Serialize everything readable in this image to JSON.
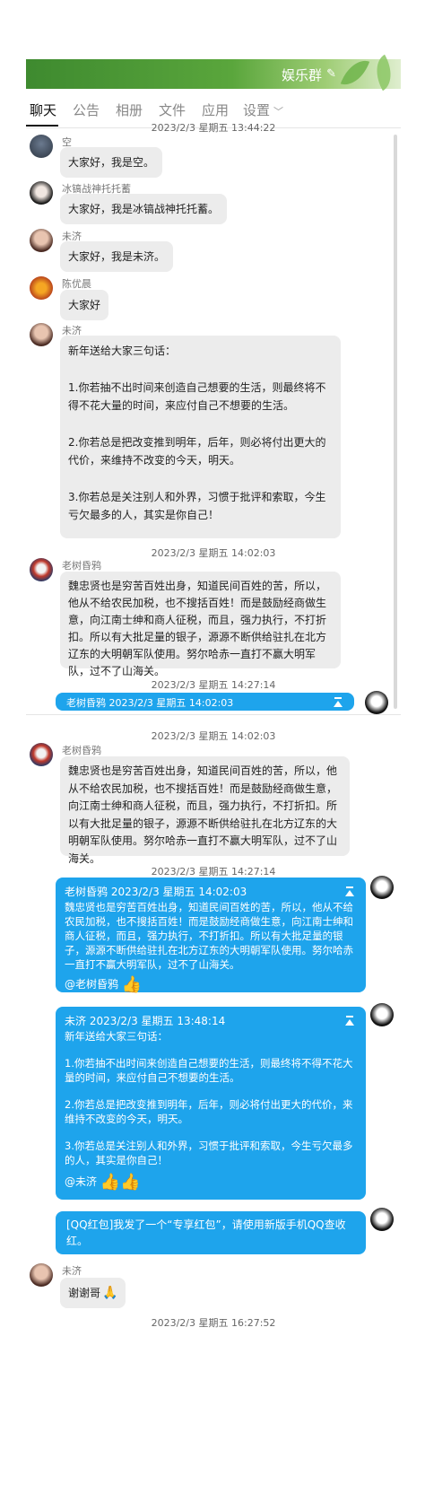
{
  "header": {
    "group_name": "娱乐群",
    "tabs": [
      "聊天",
      "公告",
      "相册",
      "文件",
      "应用",
      "设置"
    ]
  },
  "panel1": {
    "time1": "2023/2/3 星期五 13:44:22",
    "messages": [
      {
        "sender": "空",
        "text": "大家好，我是空。"
      },
      {
        "sender": "冰镐战神托托蓄",
        "text": "大家好，我是冰镐战神托托蓄。"
      },
      {
        "sender": "未济",
        "text": "大家好，我是未济。"
      },
      {
        "sender": "陈优晨",
        "text": "大家好"
      },
      {
        "sender": "未济",
        "lines": [
          "新年送给大家三句话：",
          "1.你若抽不出时间来创造自己想要的生活，则最终将不得不花大量的时间，来应付自己不想要的生活。",
          "2.你若总是把改变推到明年，后年，则必将付出更大的代价，来维持不改变的今天，明天。",
          "3.你若总是关注别人和外界，习惯于批评和索取，今生亏欠最多的人，其实是你自己！"
        ]
      }
    ],
    "time2": "2023/2/3 星期五 14:02:03",
    "lao": {
      "sender": "老树昏鸦",
      "text": "魏忠贤也是穷苦百姓出身，知道民间百姓的苦，所以，他从不给农民加税，也不搜括百姓！而是鼓励经商做生意，向江南士绅和商人征税，而且，强力执行，不打折扣。所以有大批足量的银子，源源不断供给驻扎在北方辽东的大明朝军队使用。努尔哈赤一直打不赢大明军队，过不了山海关。"
    },
    "time3": "2023/2/3 星期五 14:27:14",
    "partial_quote": "老树昏鸦    2023/2/3 星期五 14:02:03"
  },
  "panel2": {
    "time1": "2023/2/3 星期五 14:02:03",
    "lao": {
      "sender": "老树昏鸦",
      "text": "魏忠贤也是穷苦百姓出身，知道民间百姓的苦，所以，他从不给农民加税，也不搜括百姓！而是鼓励经商做生意，向江南士绅和商人征税，而且，强力执行，不打折扣。所以有大批足量的银子，源源不断供给驻扎在北方辽东的大明朝军队使用。努尔哈赤一直打不赢大明军队，过不了山海关。"
    },
    "time2": "2023/2/3 星期五 14:27:14",
    "reply1": {
      "quote_head": "老树昏鸦  2023/2/3 星期五 14:02:03",
      "quote_body": "魏忠贤也是穷苦百姓出身，知道民间百姓的苦，所以，他从不给农民加税，也不搜括百姓！而是鼓励经商做生意，向江南士绅和商人征税，而且，强力执行，不打折扣。所以有大批足量的银子，源源不断供给驻扎在北方辽东的大明朝军队使用。努尔哈赤一直打不赢大明军队，过不了山海关。",
      "mention": "@老树昏鸦"
    },
    "reply2": {
      "quote_head": "未济  2023/2/3 星期五 13:48:14",
      "quote_lines": [
        "新年送给大家三句话：",
        "1.你若抽不出时间来创造自己想要的生活，则最终将不得不花大量的时间，来应付自己不想要的生活。",
        "2.你若总是把改变推到明年，后年，则必将付出更大的代价，来维持不改变的今天，明天。",
        "3.你若总是关注别人和外界，习惯于批评和索取，今生亏欠最多的人，其实是你自己！"
      ],
      "mention": "@未济"
    },
    "redpacket": "[QQ红包]我发了一个“专享红包”，请使用新版手机QQ查收红。",
    "last": {
      "sender": "未济",
      "text": "谢谢哥"
    },
    "time3": "2023/2/3 星期五 16:27:52"
  },
  "colors": {
    "accent_blue": "#1ea4ec",
    "banner_green": "#4a9a35",
    "bubble_gray": "#ececec"
  }
}
